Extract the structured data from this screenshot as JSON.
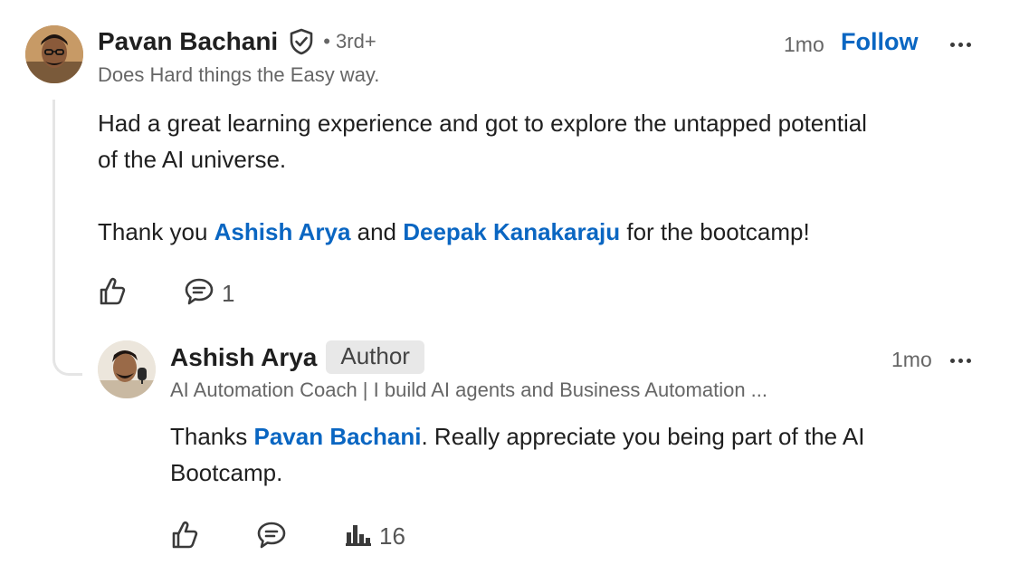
{
  "comment": {
    "author": "Pavan Bachani",
    "degree": "• 3rd+",
    "headline": "Does Hard things the Easy way.",
    "time": "1mo",
    "follow_label": "Follow",
    "body_line1": "Had a great learning experience and got to explore the untapped potential",
    "body_line2": "of the AI universe.",
    "thanks_prefix": "Thank you ",
    "mention1": "Ashish Arya",
    "thanks_mid": " and ",
    "mention2": "Deepak Kanakaraju",
    "thanks_suffix": " for the bootcamp!",
    "reply_count": "1"
  },
  "reply": {
    "author": "Ashish Arya",
    "badge": "Author",
    "headline": "AI Automation Coach | I build AI agents and Business Automation ...",
    "time": "1mo",
    "body_prefix": "Thanks ",
    "mention": "Pavan Bachani",
    "body_suffix": ". Really appreciate you being part of the AI",
    "body_line2": "Bootcamp.",
    "impressions": "16"
  },
  "icons": {
    "verified": "shield-check-icon",
    "like": "thumbs-up-icon",
    "comment": "comment-bubble-icon",
    "more": "more-dots-icon",
    "impressions": "bar-chart-icon"
  }
}
